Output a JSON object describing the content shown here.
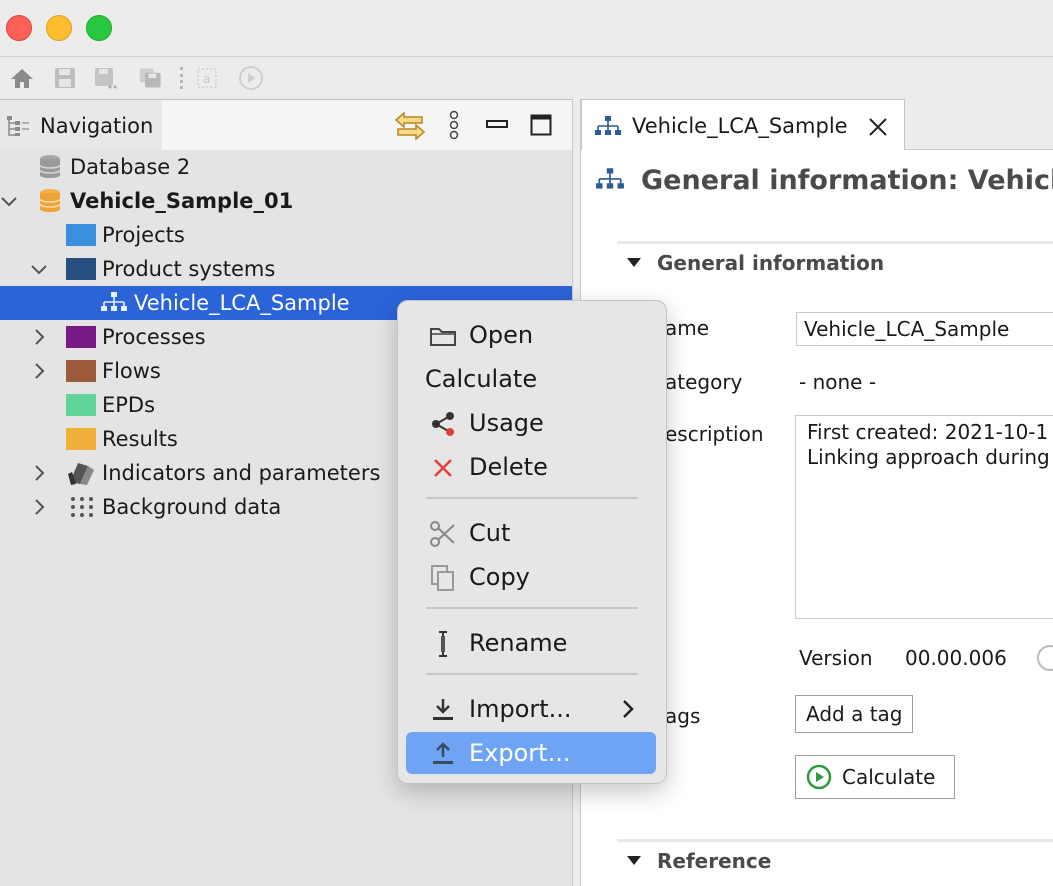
{
  "navigation": {
    "tab_label": "Navigation",
    "tree": [
      {
        "label": "Database 2",
        "color": "#9a9a9a"
      },
      {
        "label": "Vehicle_Sample_01",
        "color": "#f0a23a"
      },
      {
        "label": "Projects",
        "color": "#3b8fe0"
      },
      {
        "label": "Product systems",
        "color": "#264e80"
      },
      {
        "label": "Vehicle_LCA_Sample"
      },
      {
        "label": "Processes",
        "color": "#7a1a86"
      },
      {
        "label": "Flows",
        "color": "#9c5a3c"
      },
      {
        "label": "EPDs",
        "color": "#5fd39a"
      },
      {
        "label": "Results",
        "color": "#f0b03a"
      },
      {
        "label": "Indicators and parameters"
      },
      {
        "label": "Background data"
      }
    ]
  },
  "editor": {
    "tab_label": "Vehicle_LCA_Sample",
    "title": "General information: Vehicle_",
    "section_general": "General information",
    "name_label": "ame",
    "name_value": "Vehicle_LCA_Sample",
    "category_label": "ategory",
    "category_value": "- none -",
    "description_label": "escription",
    "description_line1": "First created: 2021-10-1",
    "description_line2": "Linking approach during",
    "version_label": "Version",
    "version_value": "00.00.006",
    "tags_label": "ags",
    "add_tag_button": "Add a tag",
    "calculate_button": "Calculate",
    "section_reference": "Reference"
  },
  "context_menu": {
    "items": [
      {
        "label": "Open"
      },
      {
        "label": "Calculate"
      },
      {
        "label": "Usage"
      },
      {
        "label": "Delete"
      },
      {
        "label": "Cut"
      },
      {
        "label": "Copy"
      },
      {
        "label": "Rename"
      },
      {
        "label": "Import..."
      },
      {
        "label": "Export..."
      }
    ],
    "highlight_color": "#6fa4f4"
  }
}
